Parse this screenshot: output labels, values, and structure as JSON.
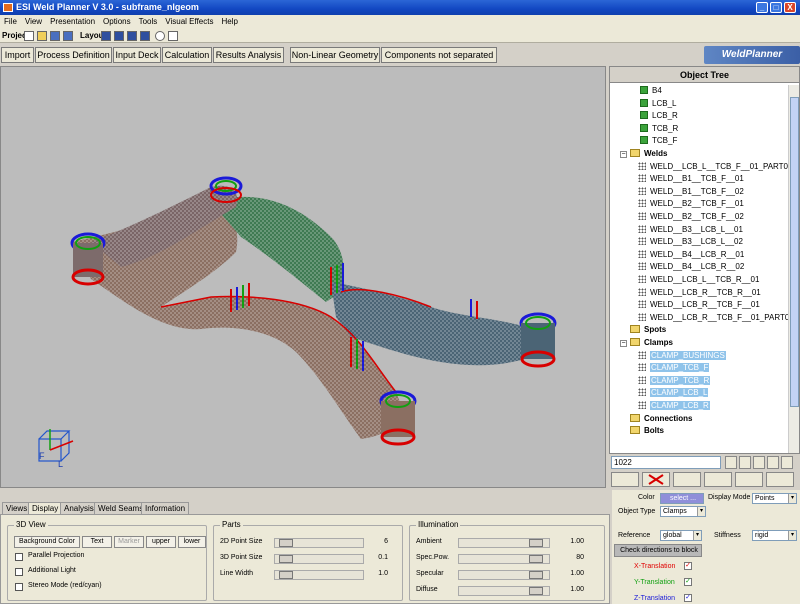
{
  "app": {
    "title": "ESI Weld Planner V 3.0 - subframe_nlgeom"
  },
  "window_controls": {
    "minimize": "_",
    "maximize": "□",
    "close": "X"
  },
  "menu": [
    "File",
    "View",
    "Presentation",
    "Options",
    "Tools",
    "Visual Effects",
    "Help"
  ],
  "toolbar": {
    "project_label": "Project",
    "layout_label": "Layout"
  },
  "main_tabs": [
    "Import",
    "Process Definition",
    "Input Deck",
    "Calculation",
    "Results Analysis",
    "Non-Linear Geometry",
    "Components not separated"
  ],
  "logo": {
    "text": "WeldPlanner"
  },
  "axis_triad": {
    "f_label": "F",
    "l_label": "L"
  },
  "object_tree": {
    "title": "Object Tree",
    "items": [
      {
        "label": "B4",
        "type": "part",
        "indent": 2
      },
      {
        "label": "LCB_L",
        "type": "part",
        "indent": 2
      },
      {
        "label": "LCB_R",
        "type": "part",
        "indent": 2
      },
      {
        "label": "TCB_R",
        "type": "part",
        "indent": 2
      },
      {
        "label": "TCB_F",
        "type": "part",
        "indent": 2
      },
      {
        "label": "Welds",
        "type": "folder",
        "indent": 0,
        "expander": "−"
      },
      {
        "label": "WELD__LCB_L__TCB_F__01_PART02",
        "type": "weld",
        "indent": 1
      },
      {
        "label": "WELD__B1__TCB_F__01",
        "type": "weld",
        "indent": 1
      },
      {
        "label": "WELD__B1__TCB_F__02",
        "type": "weld",
        "indent": 1
      },
      {
        "label": "WELD__B2__TCB_F__01",
        "type": "weld",
        "indent": 1
      },
      {
        "label": "WELD__B2__TCB_F__02",
        "type": "weld",
        "indent": 1
      },
      {
        "label": "WELD__B3__LCB_L__01",
        "type": "weld",
        "indent": 1
      },
      {
        "label": "WELD__B3__LCB_L__02",
        "type": "weld",
        "indent": 1
      },
      {
        "label": "WELD__B4__LCB_R__01",
        "type": "weld",
        "indent": 1
      },
      {
        "label": "WELD__B4__LCB_R__02",
        "type": "weld",
        "indent": 1
      },
      {
        "label": "WELD__LCB_L__TCB_R__01",
        "type": "weld",
        "indent": 1
      },
      {
        "label": "WELD__LCB_R__TCB_R__01",
        "type": "weld",
        "indent": 1
      },
      {
        "label": "WELD__LCB_R__TCB_F__01",
        "type": "weld",
        "indent": 1
      },
      {
        "label": "WELD__LCB_R__TCB_F__01_PART01",
        "type": "weld",
        "indent": 1
      },
      {
        "label": "Spots",
        "type": "folder",
        "indent": 0,
        "expander": ""
      },
      {
        "label": "Clamps",
        "type": "folder",
        "indent": 0,
        "expander": "−"
      },
      {
        "label": "CLAMP_BUSHINGS",
        "type": "weld",
        "indent": 1,
        "selected": true
      },
      {
        "label": "CLAMP_TCB_F",
        "type": "weld",
        "indent": 1,
        "selected": true
      },
      {
        "label": "CLAMP_TCB_R",
        "type": "weld",
        "indent": 1,
        "selected": true
      },
      {
        "label": "CLAMP_LCB_L",
        "type": "weld",
        "indent": 1,
        "selected": true
      },
      {
        "label": "CLAMP_LCB_R",
        "type": "weld",
        "indent": 1,
        "selected": true
      },
      {
        "label": "Connections",
        "type": "folder",
        "indent": 0,
        "expander": ""
      },
      {
        "label": "Bolts",
        "type": "folder",
        "indent": 0,
        "expander": ""
      }
    ],
    "search_value": "1022"
  },
  "bottom_tabs": [
    "Views",
    "Display",
    "Analysis",
    "Weld Seams",
    "Information"
  ],
  "view3d": {
    "title": "3D View",
    "buttons": [
      "Background Color",
      "Text",
      "Marker",
      "upper",
      "lower"
    ],
    "checks": [
      "Parallel Projection",
      "Additional Light",
      "Stereo Mode (red/cyan)"
    ]
  },
  "parts": {
    "title": "Parts",
    "rows": [
      {
        "label": "2D Point Size",
        "value": "6",
        "level": 0.06
      },
      {
        "label": "3D Point Size",
        "value": "0.1",
        "level": 0.06
      },
      {
        "label": "Line Width",
        "value": "1.0",
        "level": 0.06
      }
    ]
  },
  "illumination": {
    "title": "Illumination",
    "rows": [
      {
        "label": "Ambient",
        "value": "1.00",
        "level": 0.92
      },
      {
        "label": "Spec.Pow.",
        "value": "80",
        "level": 0.92
      },
      {
        "label": "Specular",
        "value": "1.00",
        "level": 0.92
      },
      {
        "label": "Diffuse",
        "value": "1.00",
        "level": 0.92
      }
    ]
  },
  "props": {
    "color_label": "Color",
    "color_button": "select ...",
    "display_mode_label": "Display Mode",
    "display_mode_value": "Points",
    "object_type_label": "Object Type",
    "object_type_value": "Clamps",
    "reference_label": "Reference",
    "reference_value": "global",
    "stiffness_label": "Stiffness",
    "stiffness_value": "rigid",
    "check_button": "Check directions to block",
    "x_translation": "X-Translation",
    "y_translation": "Y-Translation",
    "z_translation": "Z-Translation",
    "check_mark": "✓",
    "dropdown_glyph": "▾",
    "colors": {
      "x": "#e00000",
      "y": "#11a011",
      "z": "#1a1ad8",
      "selection": "#8fc3ea"
    }
  }
}
